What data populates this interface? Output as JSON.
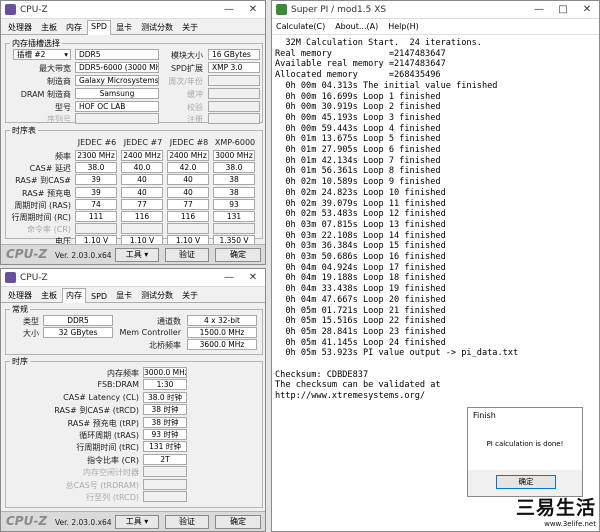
{
  "cpuz_top": {
    "title": "CPU-Z",
    "tabs": [
      "处理器",
      "主板",
      "内存",
      "SPD",
      "显卡",
      "测试分数",
      "关于"
    ],
    "active_tab": 3,
    "slot_group_title": "内存插槽选择",
    "slot_select": "插槽 #2",
    "module_type": "DDR5",
    "module_size_label": "模块大小",
    "module_size": "16 GBytes",
    "max_bw_label": "最大带宽",
    "max_bw": "DDR5-6000 (3000 MHz)",
    "spd_ext_label": "SPD扩展",
    "spd_ext": "XMP 3.0",
    "maker_label": "制造商",
    "maker": "Galaxy Microsystems Ltd.",
    "week_year_label": "周次/年份",
    "dram_maker_label": "DRAM 制造商",
    "dram_maker": "Samsung",
    "buffer_label": "缓冲",
    "model_label": "型号",
    "model": "HOF OC LAB",
    "verify_label": "校验",
    "serial_label": "序列号",
    "note_label": "注册",
    "timing_group_title": "时序表",
    "timing_cols": [
      "JEDEC #6",
      "JEDEC #7",
      "JEDEC #8",
      "XMP-6000"
    ],
    "timing_rows": [
      {
        "label": "频率",
        "values": [
          "2300 MHz",
          "2400 MHz",
          "2400 MHz",
          "3000 MHz"
        ]
      },
      {
        "label": "CAS# 延迟",
        "values": [
          "38.0",
          "40.0",
          "42.0",
          "38.0"
        ]
      },
      {
        "label": "RAS# 到CAS#",
        "values": [
          "39",
          "40",
          "40",
          "38"
        ]
      },
      {
        "label": "RAS# 预充电",
        "values": [
          "39",
          "40",
          "40",
          "38"
        ]
      },
      {
        "label": "周期时间 (RAS)",
        "values": [
          "74",
          "77",
          "77",
          "93"
        ]
      },
      {
        "label": "行周期时间 (RC)",
        "values": [
          "111",
          "116",
          "116",
          "131"
        ]
      },
      {
        "label": "命令率 (CR)",
        "values": [
          "",
          "",
          "",
          ""
        ]
      },
      {
        "label": "电压",
        "values": [
          "1.10 V",
          "1.10 V",
          "1.10 V",
          "1.350 V"
        ]
      }
    ],
    "version": "Ver. 2.03.0.x64",
    "tools_btn": "工具",
    "verify_btn": "验证",
    "ok_btn": "确定"
  },
  "cpuz_bottom": {
    "title": "CPU-Z",
    "tabs": [
      "处理器",
      "主板",
      "内存",
      "SPD",
      "显卡",
      "测试分数",
      "关于"
    ],
    "active_tab": 2,
    "general_title": "常规",
    "type_label": "类型",
    "type": "DDR5",
    "channels_label": "通道数",
    "channels": "4 x 32-bit",
    "size_label": "大小",
    "size": "32 GBytes",
    "mem_ctrl_label": "Mem Controller",
    "mem_ctrl": "1500.0 MHz",
    "nb_label": "北桥频率",
    "nb": "3600.0 MHz",
    "timing_title": "时序",
    "rows": [
      {
        "label": "内存频率",
        "value": "3000.0 MHz",
        "dim": false
      },
      {
        "label": "FSB:DRAM",
        "value": "1:30",
        "dim": false
      },
      {
        "label": "CAS# Latency (CL)",
        "value": "38.0 时钟",
        "dim": false
      },
      {
        "label": "RAS# 到CAS# (tRCD)",
        "value": "38 时钟",
        "dim": false
      },
      {
        "label": "RAS# 预充电 (tRP)",
        "value": "38 时钟",
        "dim": false
      },
      {
        "label": "循环周期 (tRAS)",
        "value": "93 时钟",
        "dim": false
      },
      {
        "label": "行周期时间 (tRC)",
        "value": "131 时钟",
        "dim": false
      },
      {
        "label": "指令比率 (CR)",
        "value": "2T",
        "dim": false
      },
      {
        "label": "内存空闲计时器",
        "value": "",
        "dim": true
      },
      {
        "label": "总CAS号 (tRDRAM)",
        "value": "",
        "dim": true
      },
      {
        "label": "行至列 (tRCD)",
        "value": "",
        "dim": true
      }
    ],
    "version": "Ver. 2.03.0.x64",
    "tools_btn": "工具",
    "verify_btn": "验证",
    "ok_btn": "确定"
  },
  "superpi": {
    "title": "Super PI / mod1.5 XS",
    "menu": [
      "Calculate(C)",
      "About...(A)",
      "Help(H)"
    ],
    "console_lines": [
      "  32M Calculation Start.  24 iterations.",
      "Real memory           =2147483647",
      "Available real memory =2147483647",
      "Allocated memory      =268435496",
      "  0h 00m 04.313s The initial value finished",
      "  0h 00m 16.699s Loop 1 finished",
      "  0h 00m 30.919s Loop 2 finished",
      "  0h 00m 45.193s Loop 3 finished",
      "  0h 00m 59.443s Loop 4 finished",
      "  0h 01m 13.675s Loop 5 finished",
      "  0h 01m 27.905s Loop 6 finished",
      "  0h 01m 42.134s Loop 7 finished",
      "  0h 01m 56.361s Loop 8 finished",
      "  0h 02m 10.589s Loop 9 finished",
      "  0h 02m 24.823s Loop 10 finished",
      "  0h 02m 39.079s Loop 11 finished",
      "  0h 02m 53.483s Loop 12 finished",
      "  0h 03m 07.815s Loop 13 finished",
      "  0h 03m 22.108s Loop 14 finished",
      "  0h 03m 36.384s Loop 15 finished",
      "  0h 03m 50.686s Loop 16 finished",
      "  0h 04m 04.924s Loop 17 finished",
      "  0h 04m 19.188s Loop 18 finished",
      "  0h 04m 33.438s Loop 19 finished",
      "  0h 04m 47.667s Loop 20 finished",
      "  0h 05m 01.721s Loop 21 finished",
      "  0h 05m 15.516s Loop 22 finished",
      "  0h 05m 28.841s Loop 23 finished",
      "  0h 05m 41.145s Loop 24 finished",
      "  0h 05m 53.923s PI value output -> pi_data.txt",
      "",
      "Checksum: CDBDE837",
      "The checksum can be validated at",
      "http://www.xtremesystems.org/"
    ]
  },
  "dialog": {
    "title": "Finish",
    "message": "PI calculation is done!",
    "ok": "确定"
  },
  "watermark": {
    "big": "三易生活",
    "small": "www.3elife.net"
  },
  "colors": {
    "cpuz_icon": "#6a4fa0",
    "superpi_icon": "#3a8a3a"
  }
}
